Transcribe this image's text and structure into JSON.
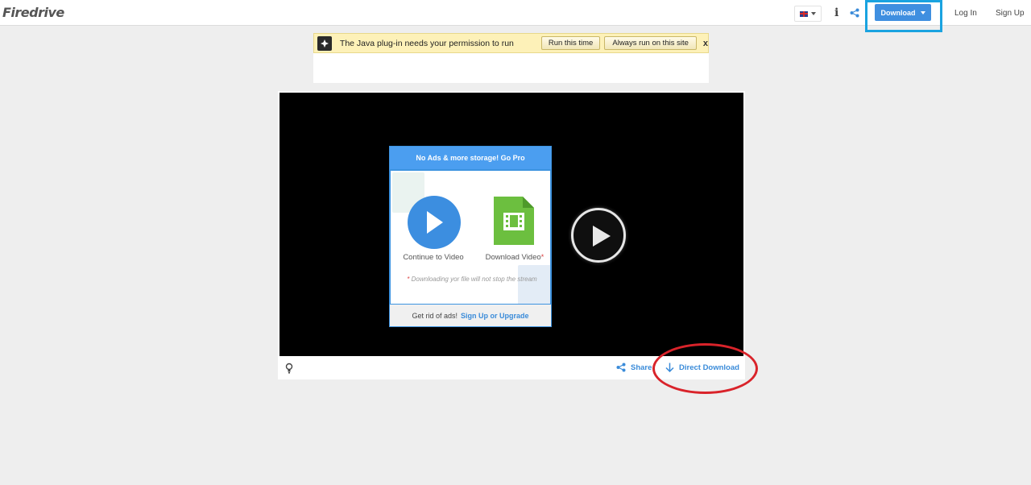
{
  "header": {
    "logo": "Firedrive",
    "download_label": "Download",
    "login_label": "Log In",
    "signup_label": "Sign Up",
    "info_glyph": "i",
    "icons": [
      "flag-uk-icon",
      "info-icon",
      "share-icon"
    ]
  },
  "java_bar": {
    "message": "The Java plug-in needs your permission to run",
    "run_once_label": "Run this time",
    "always_run_label": "Always run on this site",
    "close_label": "x"
  },
  "promo": {
    "header": "No Ads & more storage! Go Pro",
    "continue_label": "Continue to Video",
    "download_label": "Download Video",
    "download_star": "*",
    "note_star": "*",
    "note": " Downloading yor file will not stop the stream",
    "footer_text": "Get rid of ads!",
    "footer_link": "Sign Up or Upgrade"
  },
  "player_bar": {
    "share_label": "Share",
    "direct_download_label": "Direct Download"
  },
  "colors": {
    "accent_blue": "#3f8fe0",
    "highlight_blue": "#1aa3e0",
    "annotation_red": "#d9232a",
    "java_yellow": "#fdf1b8"
  }
}
